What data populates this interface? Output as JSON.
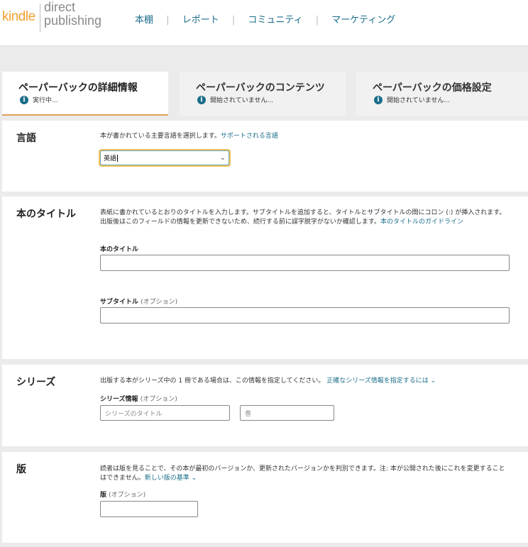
{
  "logo": {
    "kindle": "kindle",
    "direct": "direct",
    "publishing": "publishing"
  },
  "nav": [
    "本棚",
    "レポート",
    "コミュニティ",
    "マーケティング"
  ],
  "tabs": [
    {
      "title": "ペーパーバックの詳細情報",
      "status": "実行中..."
    },
    {
      "title": "ペーパーバックのコンテンツ",
      "status": "開始されていません..."
    },
    {
      "title": "ペーパーバックの価格設定",
      "status": "開始されていません..."
    }
  ],
  "language": {
    "heading": "言語",
    "desc": "本が書かれている主要言語を選択します。",
    "link": "サポートされる言語",
    "selected": "英語"
  },
  "title": {
    "heading": "本のタイトル",
    "desc": "表紙に書かれているとおりのタイトルを入力します。サブタイトルを追加すると、タイトルとサブタイトルの間にコロン (:) が挿入されます。出版後はこのフィールドの情報を更新できないため、続行する前に誤字脱字がないか確認します。",
    "link": "本のタイトルのガイドライン",
    "title_label": "本のタイトル",
    "title_value": "",
    "subtitle_label": "サブタイトル",
    "subtitle_opt": "(オプション)",
    "subtitle_value": ""
  },
  "series": {
    "heading": "シリーズ",
    "desc": "出版する本がシリーズ中の 1 冊である場合は、この情報を指定してください。",
    "link": "正確なシリーズ情報を指定するには ⌄",
    "label": "シリーズ情報",
    "opt": "(オプション)",
    "title_placeholder": "シリーズのタイトル",
    "volume_placeholder": "巻"
  },
  "edition": {
    "heading": "版",
    "desc": "読者は版を見ることで、その本が最初のバージョンか、更新されたバージョンかを判別できます。注: 本が公開された後にこれを変更することはできません。",
    "link": "新しい版の基準 ⌄",
    "label": "版",
    "opt": "(オプション)",
    "value": ""
  }
}
